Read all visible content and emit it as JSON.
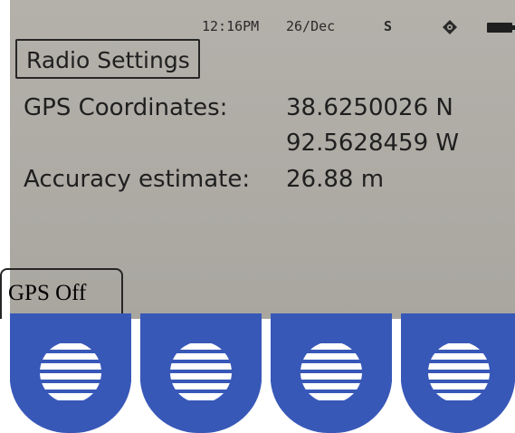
{
  "status_bar": {
    "time": "12:16PM",
    "date": "26/Dec",
    "signal": "S",
    "gps_icon": "gps-fix-icon",
    "battery_icon": "battery-icon"
  },
  "screen": {
    "title": "Radio Settings",
    "gps_label": "GPS Coordinates:",
    "latitude": "38.6250026 N",
    "longitude": "92.5628459 W",
    "accuracy_label": "Accuracy estimate:",
    "accuracy_value": "26.88 m"
  },
  "softkeys": {
    "labels": [
      "GPS Off",
      "",
      "",
      ""
    ],
    "key_icon": "speaker-grille-icon"
  },
  "colors": {
    "screen_background": "#b0ada7",
    "text": "#1f1f1f",
    "key_blue": "#3858b8",
    "key_white": "#ffffff"
  }
}
